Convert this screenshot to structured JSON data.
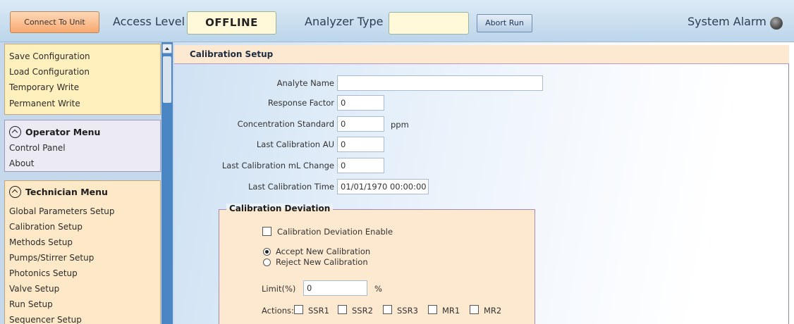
{
  "toolbar": {
    "connect_label": "Connect To Unit",
    "access_level_label": "Access Level",
    "access_level_value": "OFFLINE",
    "analyzer_type_label": "Analyzer Type",
    "analyzer_type_value": "",
    "abort_label": "Abort Run",
    "system_alarm_label": "System Alarm",
    "alarm_icon": "alarm-indicator-icon"
  },
  "sidebar": {
    "config_items": [
      "Save Configuration",
      "Load Configuration",
      "Temporary Write",
      "Permanent Write"
    ],
    "operator_menu": {
      "title": "Operator Menu",
      "items": [
        "Control Panel",
        "About"
      ]
    },
    "technician_menu": {
      "title": "Technician Menu",
      "items": [
        "Global Parameters Setup",
        "Calibration Setup",
        "Methods Setup",
        "Pumps/Stirrer Setup",
        "Photonics Setup",
        "Valve Setup",
        "Run Setup",
        "Sequencer Setup"
      ]
    }
  },
  "main": {
    "title": "Calibration Setup",
    "fields": {
      "analyte_name": {
        "label": "Analyte Name",
        "value": ""
      },
      "response_factor": {
        "label": "Response Factor",
        "value": "0"
      },
      "concentration_standard": {
        "label": "Concentration Standard",
        "value": "0",
        "unit": "ppm"
      },
      "last_calibration_au": {
        "label": "Last Calibration AU",
        "value": "0"
      },
      "last_calibration_ml": {
        "label": "Last Calibration mL Change",
        "value": "0"
      },
      "last_calibration_time": {
        "label": "Last Calibration Time",
        "value": "01/01/1970 00:00:00"
      }
    },
    "deviation": {
      "title": "Calibration Deviation",
      "enable_label": "Calibration Deviation Enable",
      "enable_checked": false,
      "accept_label": "Accept New Calibration",
      "reject_label": "Reject New Calibration",
      "selected": "accept",
      "limit_label": "Limit(%)",
      "limit_value": "0",
      "limit_unit": "%",
      "actions_label": "Actions:",
      "actions": [
        "SSR1",
        "SSR2",
        "SSR3",
        "MR1",
        "MR2"
      ]
    }
  },
  "colors": {
    "connect_button": "#f7a86f",
    "config_panel": "#fff0bd",
    "technician_panel": "#fde9c7",
    "sidebar_scrollbar": "#4a85c4",
    "group_border": "#a888b6"
  }
}
